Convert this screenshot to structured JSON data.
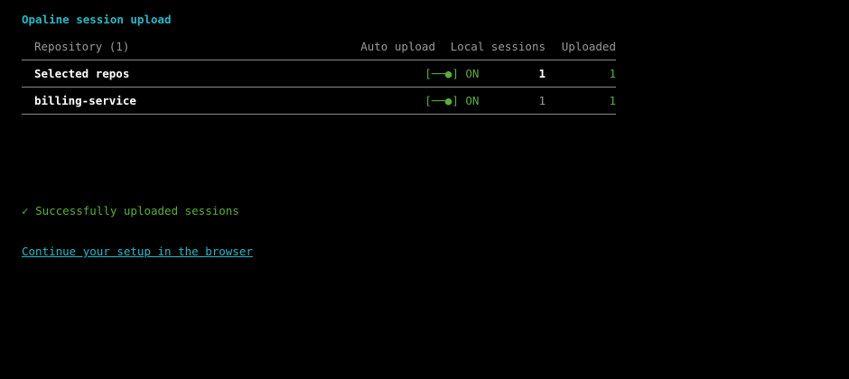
{
  "app": {
    "title": "Opaline session upload"
  },
  "table": {
    "headers": {
      "repository": "Repository (1)",
      "auto_upload": "Auto upload",
      "local_sessions": "Local sessions",
      "uploaded": "Uploaded"
    },
    "rows": [
      {
        "repository": "Selected repos",
        "toggle_glyph": "[──●]",
        "auto_upload": "ON",
        "local_sessions": "1",
        "uploaded": "1"
      },
      {
        "repository": "billing-service",
        "toggle_glyph": "[──●]",
        "auto_upload": "ON",
        "local_sessions": "1",
        "uploaded": "1"
      }
    ]
  },
  "status": {
    "check_glyph": "✓",
    "message": "Successfully uploaded sessions",
    "link_text": "Continue your setup in the browser"
  },
  "colors": {
    "accent": "#29b8c8",
    "success": "#5aad3c",
    "divider": "#8a8a8a",
    "background": "#000000"
  }
}
